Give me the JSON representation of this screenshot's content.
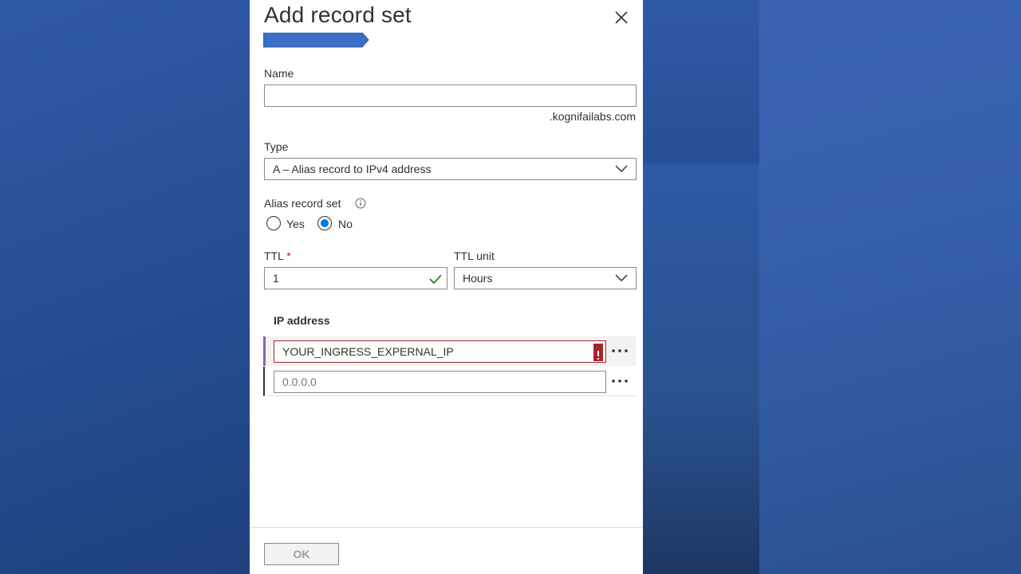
{
  "panel": {
    "title": "Add record set",
    "close_icon": "close-icon"
  },
  "name_field": {
    "label": "Name",
    "value": "",
    "suffix": ".kognifailabs.com"
  },
  "type_field": {
    "label": "Type",
    "selected": "A – Alias record to IPv4 address"
  },
  "alias": {
    "label": "Alias record set",
    "options": [
      "Yes",
      "No"
    ],
    "selected": "No"
  },
  "ttl": {
    "label": "TTL",
    "required_mark": "*",
    "value": "1"
  },
  "ttl_unit": {
    "label": "TTL unit",
    "selected": "Hours"
  },
  "ip_section": {
    "label": "IP address",
    "rows": [
      {
        "value": "YOUR_INGRESS_EXPERNAL_IP",
        "placeholder": "",
        "error": true
      },
      {
        "value": "",
        "placeholder": "0.0.0.0",
        "error": false
      }
    ],
    "more_label": "•••"
  },
  "footer": {
    "ok_label": "OK"
  },
  "colors": {
    "accent": "#0078d4",
    "error": "#a4262c",
    "success": "#107c10",
    "row_highlight": "#8764b8"
  }
}
